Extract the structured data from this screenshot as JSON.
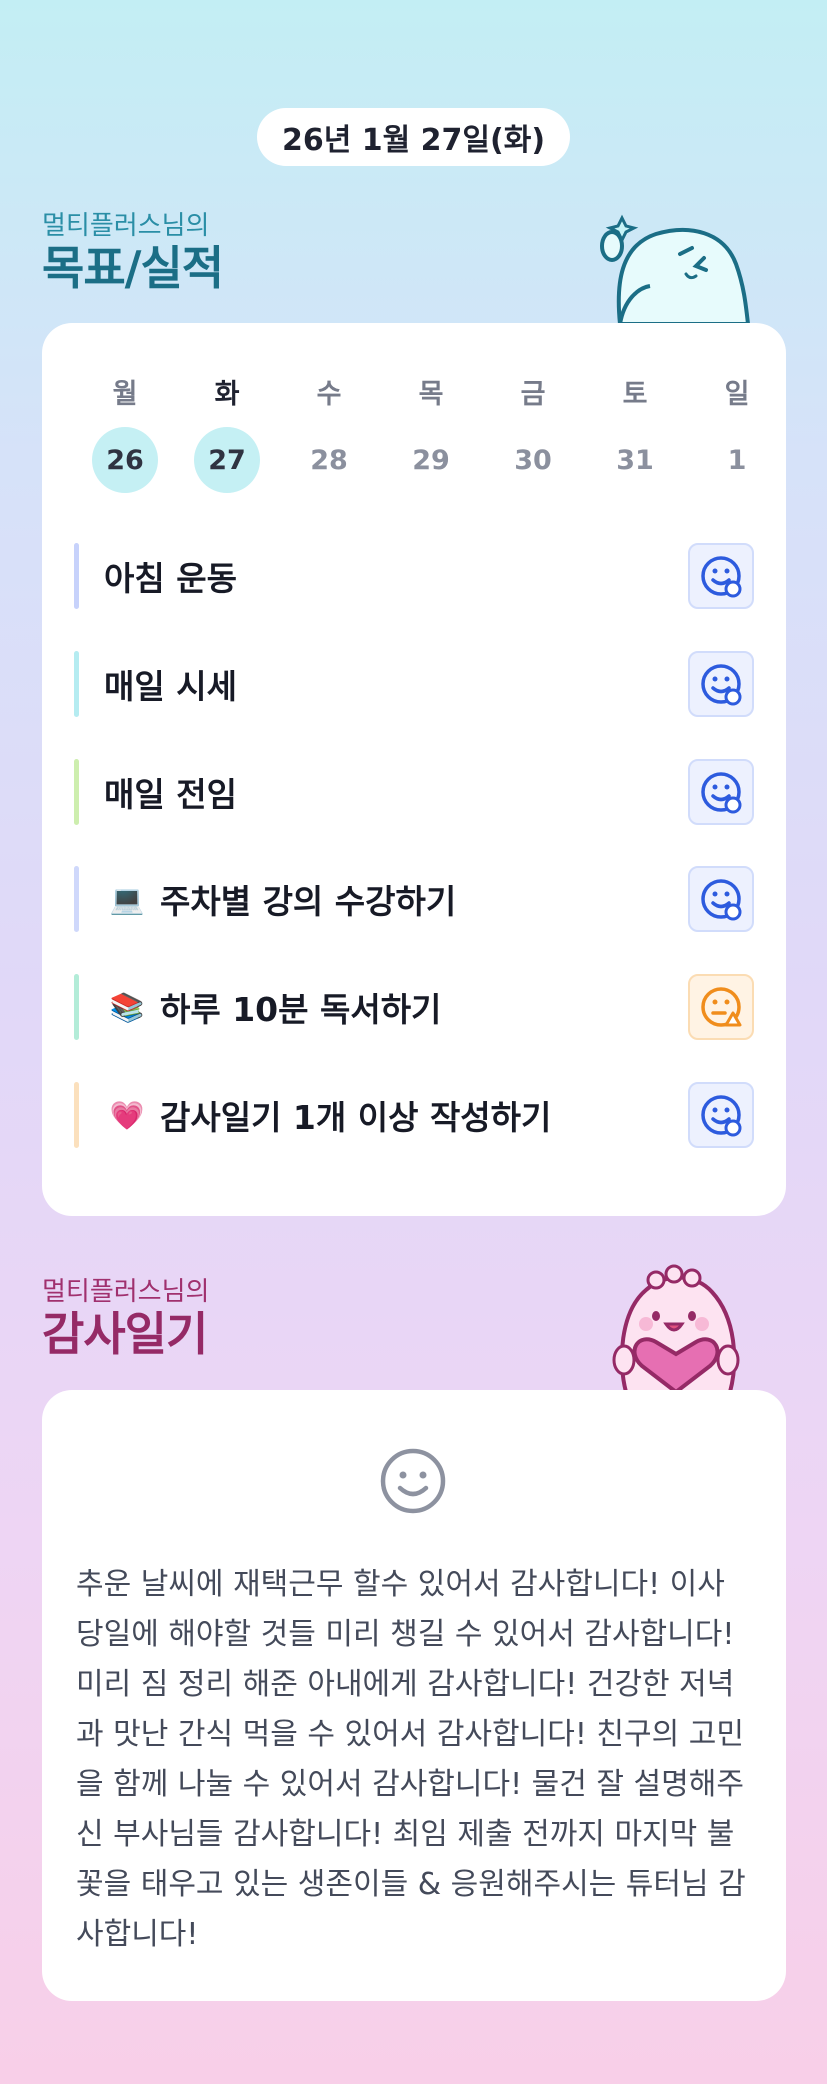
{
  "date_label": "26년 1월 27일(화)",
  "goals_section": {
    "subtitle": "멀티플러스님의",
    "title": "목표/실적"
  },
  "week": [
    {
      "weekday": "월",
      "date": "26",
      "state": "done"
    },
    {
      "weekday": "화",
      "date": "27",
      "state": "done-current"
    },
    {
      "weekday": "수",
      "date": "28",
      "state": "future"
    },
    {
      "weekday": "목",
      "date": "29",
      "state": "future"
    },
    {
      "weekday": "금",
      "date": "30",
      "state": "future"
    },
    {
      "weekday": "토",
      "date": "31",
      "state": "future"
    },
    {
      "weekday": "일",
      "date": "1",
      "state": "future"
    }
  ],
  "goals": [
    {
      "emoji": "",
      "label": "아침 운동",
      "bar_color": "#c7d2fb",
      "status": "smile-blue"
    },
    {
      "emoji": "",
      "label": "매일 시세",
      "bar_color": "#b5ecf1",
      "status": "smile-blue"
    },
    {
      "emoji": "",
      "label": "매일 전임",
      "bar_color": "#cdeeae",
      "status": "smile-blue"
    },
    {
      "emoji": "💻",
      "label": "주차별 강의 수강하기",
      "bar_color": "#cfd8fb",
      "status": "smile-blue"
    },
    {
      "emoji": "📚",
      "label": "하루 10분 독서하기",
      "bar_color": "#b3ecd8",
      "status": "meh-orange"
    },
    {
      "emoji": "💗",
      "label": "감사일기 1개 이상 작성하기",
      "bar_color": "#fbe0bd",
      "status": "smile-blue"
    }
  ],
  "diary_section": {
    "subtitle": "멀티플러스님의",
    "title": "감사일기",
    "mood_icon": "smile-face-icon",
    "text": "추운 날씨에 재택근무 할수 있어서 감사합니다! 이사 당일에 해야할 것들 미리 챙길 수 있어서 감사합니다! 미리 짐 정리 해준 아내에게 감사합니다! 건강한 저녁과 맛난 간식 먹을 수 있어서 감사합니다! 친구의 고민을 함께 나눌 수 있어서 감사합니다! 물건 잘 설명해주신 부사님들 감사합니다! 최임 제출 전까지 마지막 불꽃을 태우고 있는 생존이들 & 응원해주시는 튜터님 감사합니다!"
  },
  "colors": {
    "goals_title": "#1b6e86",
    "diary_title": "#952a66",
    "done_circle": "#c5f0f4",
    "status_blue": "#2d5bde",
    "status_orange": "#f08d1c"
  }
}
